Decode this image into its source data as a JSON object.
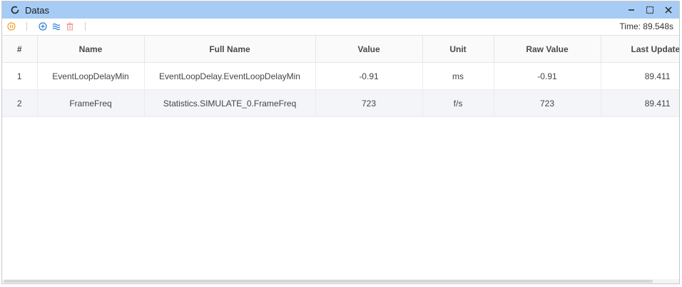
{
  "window": {
    "title": "Datas",
    "controls": [
      "minimize-icon",
      "maximize-icon",
      "close-icon"
    ]
  },
  "toolbar": {
    "buttons": [
      "pause-icon",
      "add-icon",
      "waves-icon",
      "delete-icon"
    ],
    "time_label": "Time: 89.548s"
  },
  "table": {
    "headers": [
      "#",
      "Name",
      "Full Name",
      "Value",
      "Unit",
      "Raw Value",
      "Last Update"
    ],
    "rows": [
      {
        "idx": "1",
        "name": "EventLoopDelayMin",
        "full_name": "EventLoopDelay.EventLoopDelayMin",
        "value": "-0.91",
        "unit": "ms",
        "raw_value": "-0.91",
        "last_update": "89.411"
      },
      {
        "idx": "2",
        "name": "FrameFreq",
        "full_name": "Statistics.SIMULATE_0.FrameFreq",
        "value": "723",
        "unit": "f/s",
        "raw_value": "723",
        "last_update": "89.411"
      }
    ]
  },
  "colors": {
    "titlebar": "#a6ccf5",
    "pause": "#f0a02a",
    "add": "#2f7bd8",
    "delete": "#f0a0a0"
  }
}
